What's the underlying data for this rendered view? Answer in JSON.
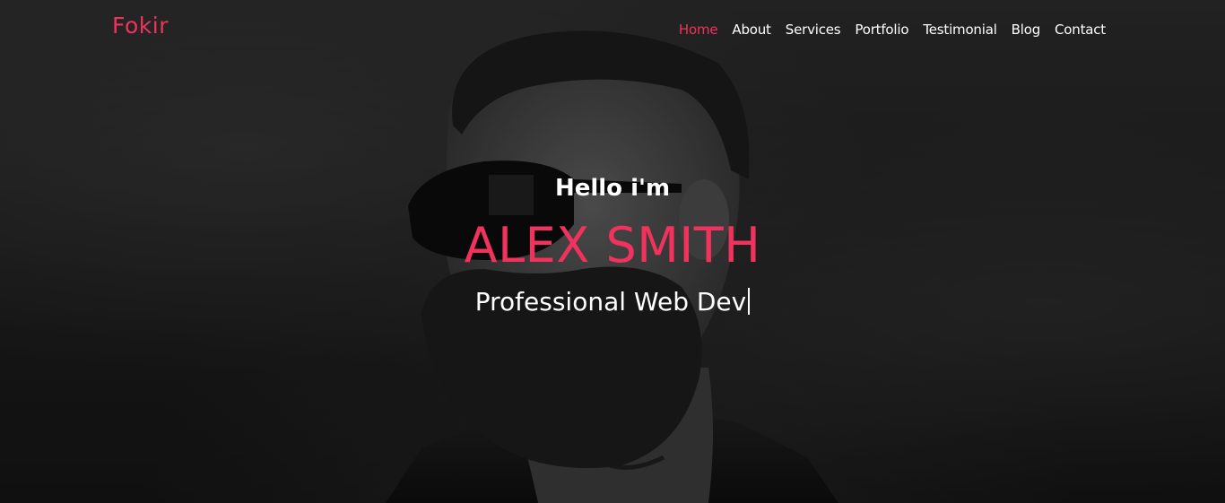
{
  "brand": {
    "logo": "Fokir"
  },
  "nav": {
    "items": [
      {
        "label": "Home",
        "active": true
      },
      {
        "label": "About"
      },
      {
        "label": "Services"
      },
      {
        "label": "Portfolio"
      },
      {
        "label": "Testimonial"
      },
      {
        "label": "Blog"
      },
      {
        "label": "Contact"
      }
    ]
  },
  "hero": {
    "greeting": "Hello i'm",
    "name": "ALEX SMITH",
    "role": "Professional Web Dev"
  },
  "colors": {
    "accent": "#f0325c",
    "text": "#ffffff",
    "background": "#1c1c1c"
  }
}
